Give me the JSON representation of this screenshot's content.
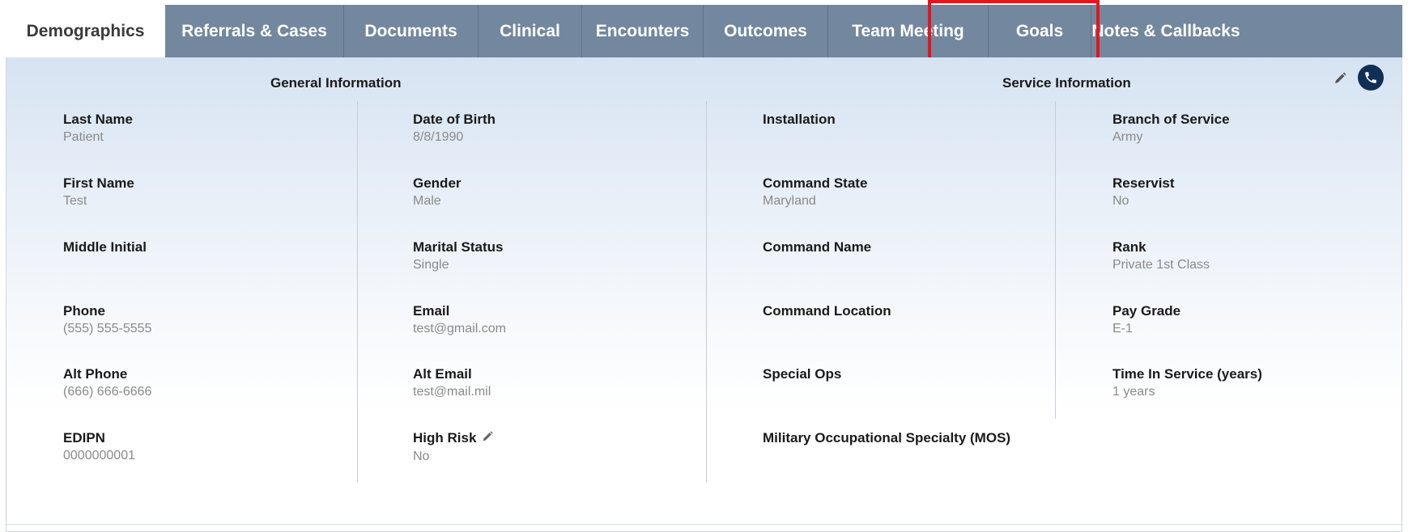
{
  "tabs": [
    {
      "label": "Demographics",
      "active": true
    },
    {
      "label": "Referrals & Cases"
    },
    {
      "label": "Documents"
    },
    {
      "label": "Clinical"
    },
    {
      "label": "Encounters"
    },
    {
      "label": "Outcomes"
    },
    {
      "label": "Team Meeting",
      "highlighted": true
    },
    {
      "label": "Goals"
    },
    {
      "label": "Notes & Callbacks"
    }
  ],
  "general": {
    "title": "General Information",
    "col1": [
      {
        "label": "Last Name",
        "value": "Patient"
      },
      {
        "label": "First Name",
        "value": "Test"
      },
      {
        "label": "Middle Initial",
        "value": ""
      },
      {
        "label": "Phone",
        "value": "(555) 555-5555"
      },
      {
        "label": "Alt Phone",
        "value": "(666) 666-6666"
      },
      {
        "label": "EDIPN",
        "value": "0000000001"
      }
    ],
    "col2": [
      {
        "label": "Date of Birth",
        "value": "8/8/1990"
      },
      {
        "label": "Gender",
        "value": "Male"
      },
      {
        "label": "Marital Status",
        "value": "Single"
      },
      {
        "label": "Email",
        "value": "test@gmail.com"
      },
      {
        "label": "Alt Email",
        "value": "test@mail.mil"
      },
      {
        "label": "High Risk",
        "value": "No"
      }
    ]
  },
  "service": {
    "title": "Service Information",
    "col3": [
      {
        "label": "Installation",
        "value": ""
      },
      {
        "label": "Command State",
        "value": "Maryland"
      },
      {
        "label": "Command Name",
        "value": ""
      },
      {
        "label": "Command Location",
        "value": ""
      },
      {
        "label": "Special Ops",
        "value": ""
      },
      {
        "label": "Military Occupational Specialty (MOS)",
        "value": ""
      }
    ],
    "col4": [
      {
        "label": "Branch of Service",
        "value": "Army"
      },
      {
        "label": "Reservist",
        "value": "No"
      },
      {
        "label": "Rank",
        "value": "Private 1st Class"
      },
      {
        "label": "Pay Grade",
        "value": "E-1"
      },
      {
        "label": "Time In Service (years)",
        "value": "1 years"
      }
    ]
  },
  "icons": {
    "edit": "pencil-icon",
    "call": "phone-icon"
  },
  "colors": {
    "tab_bg": "#73879e",
    "highlight": "#e3161e",
    "phone_bg": "#0f2f57"
  }
}
